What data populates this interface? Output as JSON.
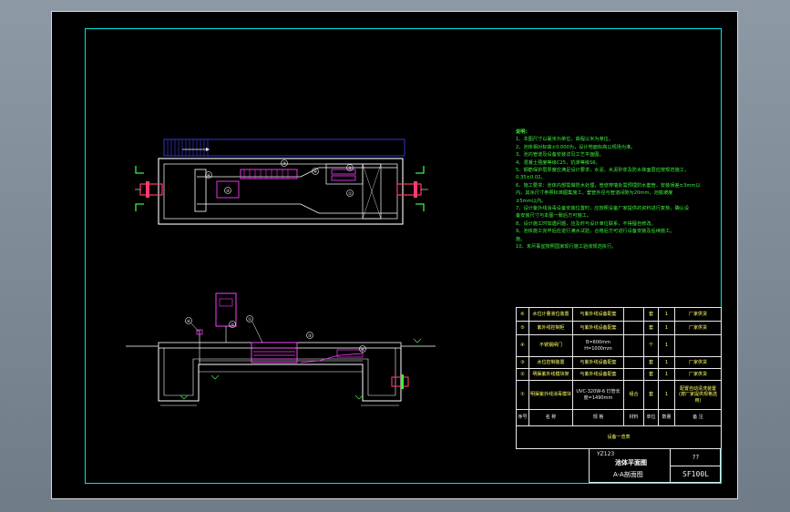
{
  "notes": {
    "heading": "说明：",
    "lines": [
      "1、本图尺寸以毫米为单位，高程以米为单位。",
      "2、池体相对标高±0.000为，设计地面标高以现场为准。",
      "3、池内管道及设备安装详见工艺平面图。",
      "4、混凝土强度等级C25，抗渗等级S6。",
      "5、钢筋保护层厚度应满足设计要求，水泥、水泥砂浆及防水抹面层应按规范施工，",
      "   0.35±0.02。",
      "6、施工要求：池体内部需做防水处理，管道穿墙处需预埋防水套管，安装误差±3mm以",
      "   内，其余尺寸参照标准图集施工，套管外径与管道间隙为20mm，池底坡度",
      "   ±5mm以内。",
      "7、设计紫外线消毒设备安装位置时，应按照设备厂家提供的资料进行复核，确认设",
      "   备安装尺寸与本图一致后方可施工。",
      "8、设计施工时如遇问题，应及时与设计单位联系，不得擅自修改。",
      "9、池体施工完毕后应进行满水试验，合格后方可进行设备安装及后续施工。",
      "   施。",
      "10、未尽事宜按照国家现行施工验收规范执行。"
    ]
  },
  "equipment_table": {
    "rows": [
      {
        "no": "⑥",
        "name": "水位计量液位装置",
        "spec": "与紫外线设备配套",
        "material": "",
        "unit": "套",
        "qty": "1",
        "remark": "厂家供货"
      },
      {
        "no": "⑤",
        "name": "紫外线控制柜",
        "spec": "与紫外线设备配套",
        "material": "",
        "unit": "套",
        "qty": "1",
        "remark": "厂家供货"
      },
      {
        "no": "④",
        "name": "不锈钢闸门",
        "spec": "B=600mm H=1000mm",
        "material": "",
        "unit": "个",
        "qty": "1",
        "remark": ""
      },
      {
        "no": "③",
        "name": "水位控制装置",
        "spec": "与紫外线设备配套",
        "material": "",
        "unit": "套",
        "qty": "1",
        "remark": "厂家供货"
      },
      {
        "no": "②",
        "name": "明渠紫外线模块架",
        "spec": "与紫外线设备配套",
        "material": "",
        "unit": "套",
        "qty": "1",
        "remark": "厂家供货"
      },
      {
        "no": "①",
        "name": "明渠紫外线消毒模块",
        "spec": "UVC-320W-6 灯管长度=1490mm",
        "material": "组合",
        "unit": "套",
        "qty": "1",
        "remark": "配置自动清洗装置 (按厂家提供规格选用)"
      }
    ],
    "header": {
      "no": "序号",
      "name": "名 称",
      "spec": "规 格",
      "material": "材料",
      "unit": "单位",
      "qty": "数量",
      "remark": "备 注"
    },
    "footer": "设备一览表"
  },
  "title_block": {
    "code": "YZ123",
    "title_line1": "池体平面图",
    "title_line2": "A-A剖面图",
    "scale": "??",
    "drawing_no": "SF100L"
  },
  "plan_labels": [
    "⑥",
    "⑤",
    "③",
    "④",
    "①",
    "②"
  ],
  "section_labels": [
    "⑥",
    "⑤",
    "①",
    "③",
    "④"
  ],
  "colors": {
    "background": "#000000",
    "frame": "#00e5e5",
    "notes": "#3ef03e",
    "table_text": "#ffff66",
    "pipe": "#ff3b6b",
    "equipment": "#ff3bff",
    "lines": "#ffffff",
    "hatch": "#4040ff"
  }
}
